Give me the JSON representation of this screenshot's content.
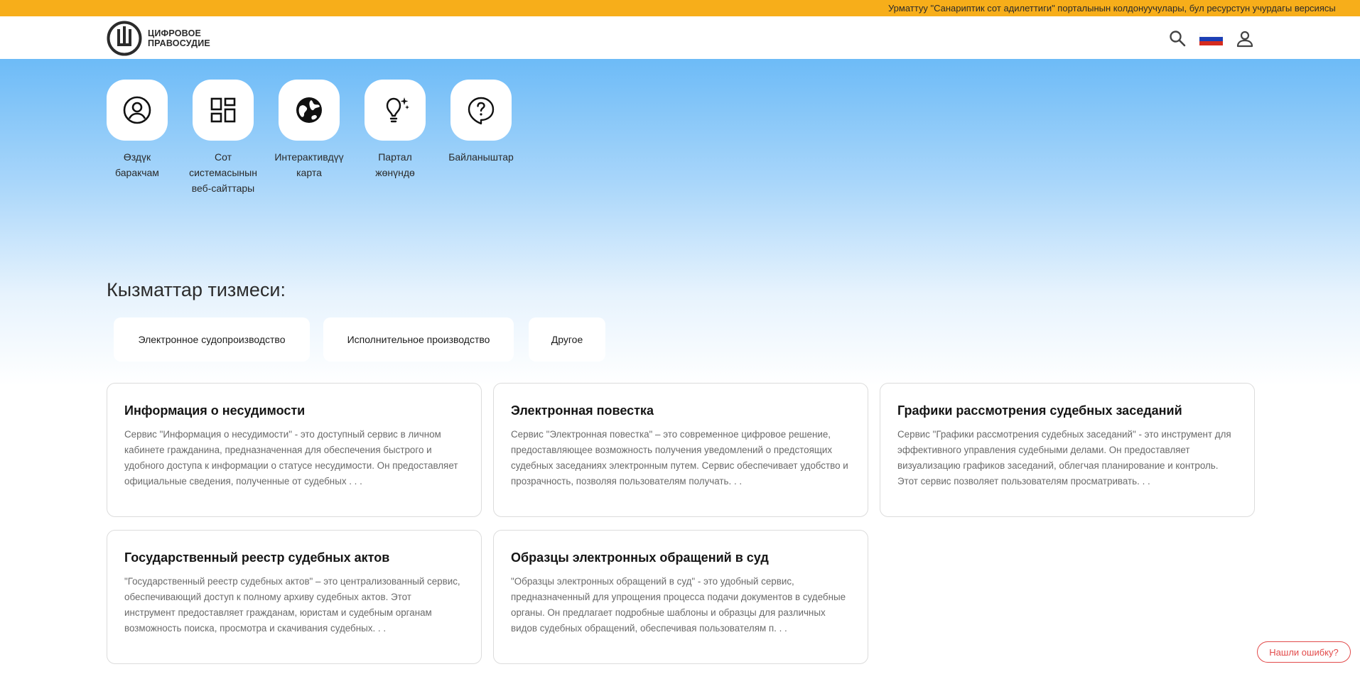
{
  "ticker": {
    "text": "Урматтуу \"Санариптик сот адилеттиги\" порталынын колдонуучулары, бул ресурстун учурдагы версиясы"
  },
  "header": {
    "logo_line1": "ЦИФРОВОЕ",
    "logo_line2": "ПРАВОСУДИЕ",
    "icons": [
      "search-icon",
      "russian-flag-icon",
      "user-icon"
    ]
  },
  "quick_links": [
    {
      "label": "Өздүк баракчам",
      "icon": "user-circle-icon"
    },
    {
      "label": "Сот системасынын веб-сайттары",
      "icon": "grid-icon"
    },
    {
      "label": "Интерактивдүү карта",
      "icon": "globe-icon"
    },
    {
      "label": "Партал жөнүндө",
      "icon": "lightbulb-icon"
    },
    {
      "label": "Байланыштар",
      "icon": "question-bubble-icon"
    }
  ],
  "services": {
    "title": "Кызматтар тизмеси:",
    "filters": [
      "Электронное судопроизводство",
      "Исполнительное производство",
      "Другое"
    ]
  },
  "cards": [
    {
      "title": "Информация о несудимости",
      "desc": "Сервис \"Информация о несудимости\" - это доступный сервис в личном кабинете гражданина, предназначенная для обеспечения быстрого и удобного доступа к информации о статусе несудимости. Он предоставляет официальные сведения, полученные от судебных . . ."
    },
    {
      "title": "Электронная повестка",
      "desc": "Сервис \"Электронная повестка\" – это современное цифровое решение, предоставляющее возможность получения уведомлений о предстоящих судебных заседаниях электронным путем. Сервис обеспечивает удобство и прозрачность, позволяя пользователям получать. . ."
    },
    {
      "title": "Графики рассмотрения судебных заседаний",
      "desc": "Сервис \"Графики рассмотрения судебных заседаний\" - это инструмент для эффективного управления судебными делами. Он предоставляет визуализацию графиков заседаний, облегчая планирование и контроль. Этот сервис позволяет пользователям просматривать. . ."
    },
    {
      "title": "Государственный реестр судебных актов",
      "desc": "\"Государственный реестр судебных актов\" – это централизованный сервис, обеспечивающий доступ к полному архиву судебных актов. Этот инструмент предоставляет гражданам, юристам и судебным органам возможность поиска, просмотра и скачивания судебных. . ."
    },
    {
      "title": "Образцы электронных обращений в суд",
      "desc": "\"Образцы электронных обращений в суд\" - это удобный сервис, предназначенный для упрощения процесса подачи документов в судебные органы. Он предлагает подробные шаблоны и образцы для различных видов судебных обращений, обеспечивая пользователям п. . ."
    }
  ],
  "report_error": "Нашли ошибку?",
  "colors": {
    "ticker_bg": "#f7ae1a",
    "hero_top": "#6dbbf7",
    "accent_red": "#e24b4b"
  }
}
